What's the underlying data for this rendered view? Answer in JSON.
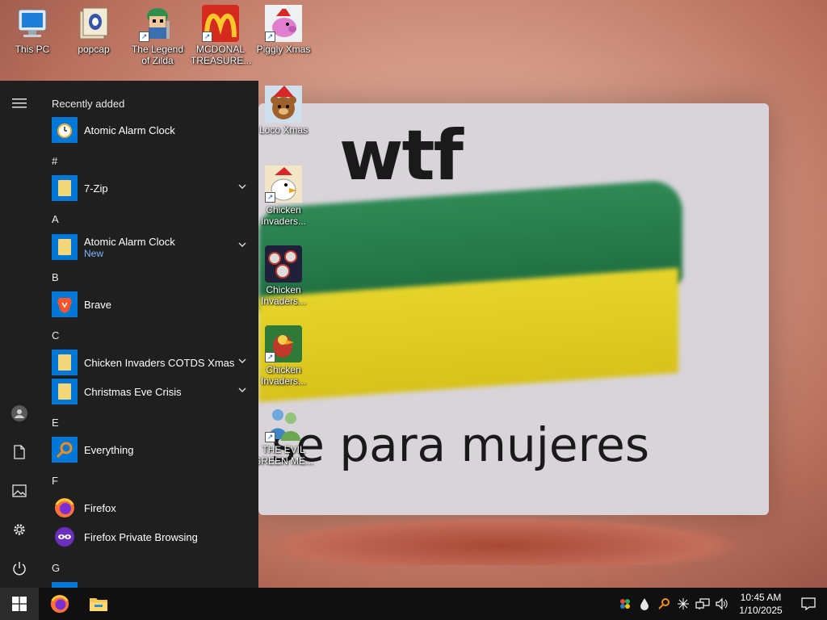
{
  "wallpaper": {
    "top_text": "wtf",
    "bottom_text": "se para mujeres"
  },
  "desktop_icons": [
    {
      "label": "This PC",
      "icon": "computer-icon",
      "shortcut": false
    },
    {
      "label": "popcap",
      "icon": "folder-icon",
      "shortcut": false
    },
    {
      "label": "The Legend of Zilda",
      "icon": "game-character-icon",
      "shortcut": true
    },
    {
      "label": "MCDONAL TREASURE...",
      "icon": "mcdonalds-logo-icon",
      "shortcut": true
    },
    {
      "label": "Piggly Xmas",
      "icon": "pig-icon",
      "shortcut": true
    },
    {
      "label": "Loco Xmas",
      "icon": "bear-icon",
      "shortcut": true
    },
    {
      "label": "Chicken Invaders...",
      "icon": "chicken-icon",
      "shortcut": true
    },
    {
      "label": "Chicken Invaders...",
      "icon": "chicken-invaders-icon",
      "shortcut": true
    },
    {
      "label": "Chicken Invaders...",
      "icon": "chicken-invaders-icon",
      "shortcut": true
    },
    {
      "label": "THE EVIL GREEN ME...",
      "icon": "people-icon",
      "shortcut": true
    }
  ],
  "start_menu": {
    "groups": {
      "recent": "Recently added",
      "hash": "#",
      "a": "A",
      "b": "B",
      "c": "C",
      "e": "E",
      "f": "F",
      "g": "G"
    },
    "apps": {
      "recent_atomic": "Atomic Alarm Clock",
      "sevenzip": "7-Zip",
      "atomic": "Atomic Alarm Clock",
      "atomic_new": "New",
      "brave": "Brave",
      "chicken_folder": "Chicken Invaders COTDS Xmas",
      "christmas_eve": "Christmas Eve Crisis",
      "everything": "Everything",
      "firefox": "Firefox",
      "firefox_private": "Firefox Private Browsing"
    },
    "rail_icons": [
      "menu-icon",
      "user-icon",
      "documents-icon",
      "pictures-icon",
      "settings-icon",
      "power-icon"
    ]
  },
  "taskbar": {
    "time": "10:45 AM",
    "date": "1/10/2025",
    "pinned": [
      "windows-start-icon",
      "firefox-icon",
      "file-explorer-icon"
    ],
    "tray": [
      "colorful-app-icon",
      "drop-icon",
      "search-app-icon",
      "network-hub-icon",
      "network-icon",
      "volume-icon",
      "notification-icon"
    ]
  }
}
